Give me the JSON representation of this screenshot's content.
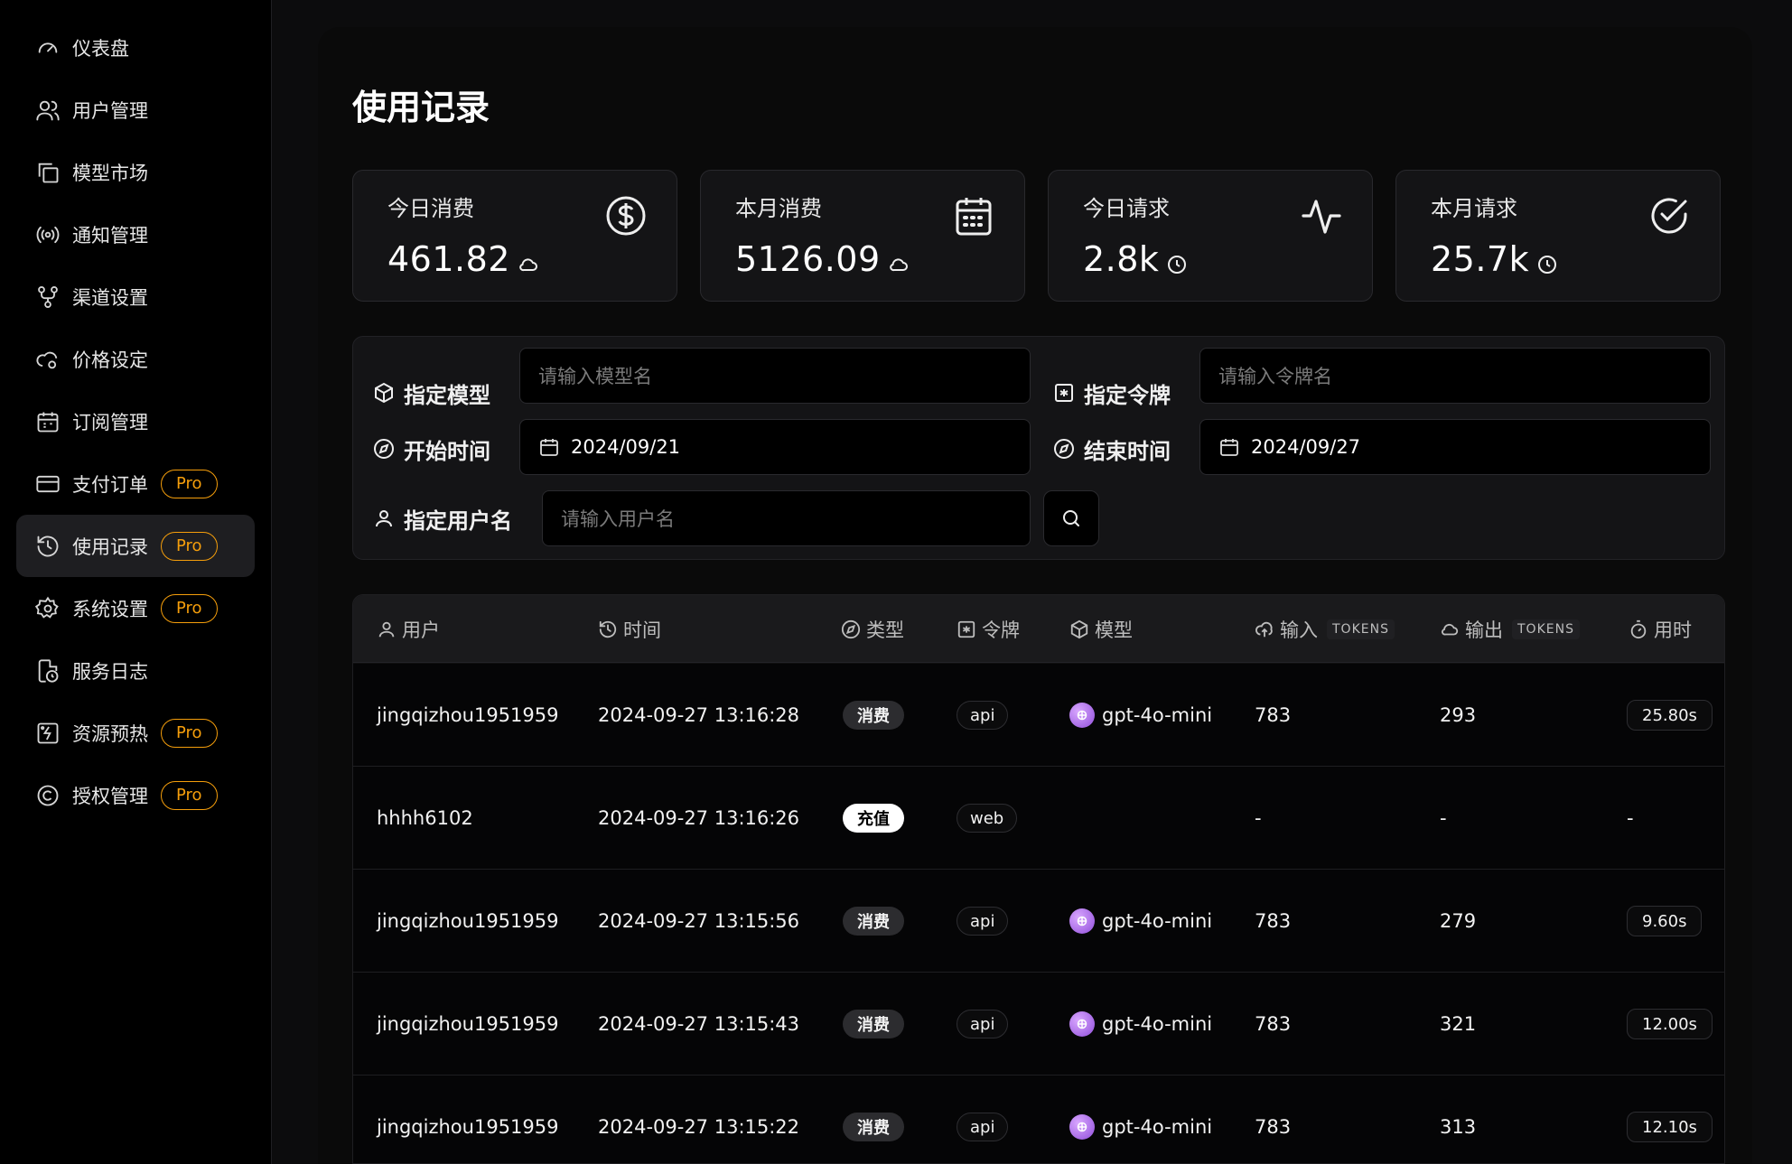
{
  "sidebar": {
    "items": [
      {
        "label": "仪表盘",
        "icon": "gauge-icon",
        "pro": ""
      },
      {
        "label": "用户管理",
        "icon": "users-icon",
        "pro": ""
      },
      {
        "label": "模型市场",
        "icon": "copy-icon",
        "pro": ""
      },
      {
        "label": "通知管理",
        "icon": "radio-icon",
        "pro": ""
      },
      {
        "label": "渠道设置",
        "icon": "git-fork-icon",
        "pro": ""
      },
      {
        "label": "价格设定",
        "icon": "cloud-cog-icon",
        "pro": ""
      },
      {
        "label": "订阅管理",
        "icon": "calendar-icon",
        "pro": ""
      },
      {
        "label": "支付订单",
        "icon": "credit-card-icon",
        "pro": "Pro"
      },
      {
        "label": "使用记录",
        "icon": "history-icon",
        "pro": "Pro",
        "active": true
      },
      {
        "label": "系统设置",
        "icon": "settings-icon",
        "pro": "Pro"
      },
      {
        "label": "服务日志",
        "icon": "file-clock-icon",
        "pro": ""
      },
      {
        "label": "资源预热",
        "icon": "image-bolt-icon",
        "pro": "Pro"
      },
      {
        "label": "授权管理",
        "icon": "copyright-icon",
        "pro": "Pro"
      }
    ]
  },
  "page": {
    "title": "使用记录"
  },
  "stats": [
    {
      "label": "今日消费",
      "value": "461.82",
      "unit_icon": "cloud-icon",
      "icon": "dollar-circle-icon"
    },
    {
      "label": "本月消费",
      "value": "5126.09",
      "unit_icon": "cloud-icon",
      "icon": "calendar-grid-icon"
    },
    {
      "label": "今日请求",
      "value": "2.8k",
      "unit_icon": "clock-icon",
      "icon": "activity-icon"
    },
    {
      "label": "本月请求",
      "value": "25.7k",
      "unit_icon": "clock-icon",
      "icon": "check-circle-icon"
    }
  ],
  "filters": {
    "model_label": "指定模型",
    "model_placeholder": "请输入模型名",
    "token_label": "指定令牌",
    "token_placeholder": "请输入令牌名",
    "start_label": "开始时间",
    "start_value": "2024/09/21",
    "end_label": "结束时间",
    "end_value": "2024/09/27",
    "user_label": "指定用户名",
    "user_placeholder": "请输入用户名"
  },
  "table": {
    "headers": {
      "user": "用户",
      "time": "时间",
      "type": "类型",
      "token": "令牌",
      "model": "模型",
      "input": "输入",
      "input_sub": "TOKENS",
      "output": "输出",
      "output_sub": "TOKENS",
      "duration": "用时"
    },
    "rows": [
      {
        "user": "jingqizhou1951959",
        "time": "2024-09-27 13:16:28",
        "type": "消费",
        "type_kind": "consume",
        "token": "api",
        "model": "gpt-4o-mini",
        "input": "783",
        "output": "293",
        "duration": "25.80s"
      },
      {
        "user": "hhhh6102",
        "time": "2024-09-27 13:16:26",
        "type": "充值",
        "type_kind": "topup",
        "token": "web",
        "model": "",
        "input": "-",
        "output": "-",
        "duration": "-"
      },
      {
        "user": "jingqizhou1951959",
        "time": "2024-09-27 13:15:56",
        "type": "消费",
        "type_kind": "consume",
        "token": "api",
        "model": "gpt-4o-mini",
        "input": "783",
        "output": "279",
        "duration": "9.60s"
      },
      {
        "user": "jingqizhou1951959",
        "time": "2024-09-27 13:15:43",
        "type": "消费",
        "type_kind": "consume",
        "token": "api",
        "model": "gpt-4o-mini",
        "input": "783",
        "output": "321",
        "duration": "12.00s"
      },
      {
        "user": "jingqizhou1951959",
        "time": "2024-09-27 13:15:22",
        "type": "消费",
        "type_kind": "consume",
        "token": "api",
        "model": "gpt-4o-mini",
        "input": "783",
        "output": "313",
        "duration": "12.10s"
      }
    ]
  }
}
